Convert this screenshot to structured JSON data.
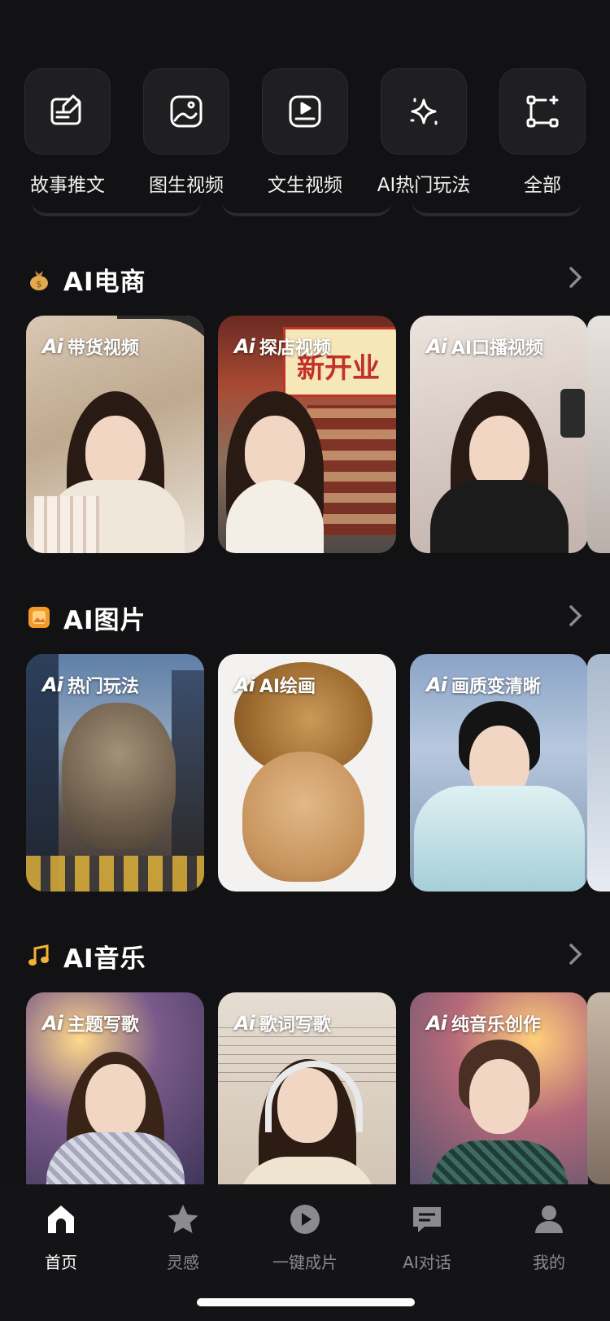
{
  "quick_tools": [
    {
      "label": "故事推文",
      "icon": "story-card-icon"
    },
    {
      "label": "图生视频",
      "icon": "image-to-video-icon"
    },
    {
      "label": "文生视频",
      "icon": "text-to-video-icon"
    },
    {
      "label": "AI热门玩法",
      "icon": "sparkle-icon"
    },
    {
      "label": "全部",
      "icon": "all-nodes-icon"
    }
  ],
  "sections": [
    {
      "title": "AI电商",
      "emoji": "money-bag-icon",
      "cards": [
        {
          "ai_badge": "Ai",
          "label": "带货视频"
        },
        {
          "ai_badge": "Ai",
          "label": "探店视频"
        },
        {
          "ai_badge": "Ai",
          "label": "AI口播视频"
        }
      ]
    },
    {
      "title": "AI图片",
      "emoji": "picture-icon",
      "cards": [
        {
          "ai_badge": "Ai",
          "label": "热门玩法"
        },
        {
          "ai_badge": "Ai",
          "label": "AI绘画"
        },
        {
          "ai_badge": "Ai",
          "label": "画质变清晰"
        }
      ]
    },
    {
      "title": "AI音乐",
      "emoji": "music-note-icon",
      "cards": [
        {
          "ai_badge": "Ai",
          "label": "主题写歌"
        },
        {
          "ai_badge": "Ai",
          "label": "歌词写歌"
        },
        {
          "ai_badge": "Ai",
          "label": "纯音乐创作"
        }
      ]
    }
  ],
  "storefront_sign": "新开业",
  "tabbar": [
    {
      "label": "首页",
      "icon": "home-icon",
      "active": true
    },
    {
      "label": "灵感",
      "icon": "star-icon",
      "active": false
    },
    {
      "label": "一键成片",
      "icon": "play-icon",
      "active": false
    },
    {
      "label": "AI对话",
      "icon": "chat-icon",
      "active": false
    },
    {
      "label": "我的",
      "icon": "profile-icon",
      "active": false
    }
  ],
  "colors": {
    "background": "#121214",
    "tile": "#1f1f22",
    "inactive_tab": "#8a8a8f"
  }
}
